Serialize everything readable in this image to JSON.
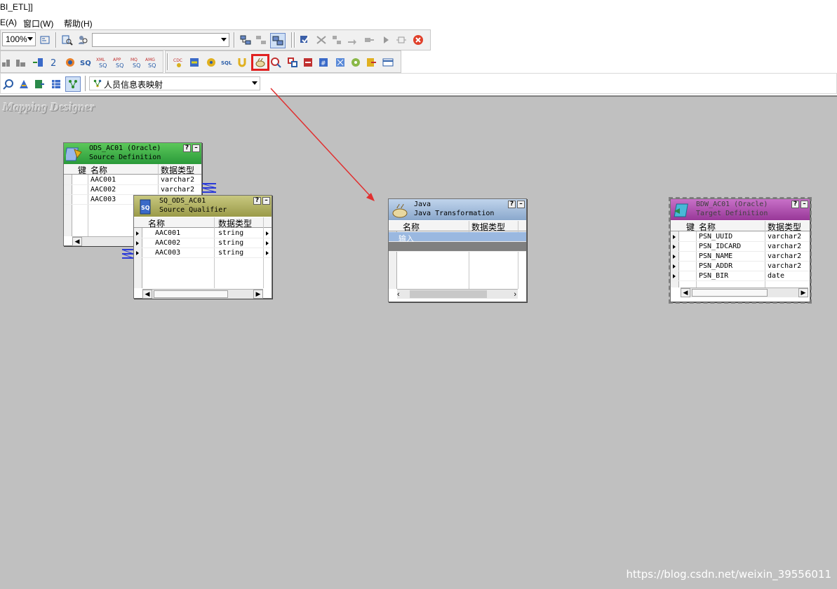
{
  "window": {
    "title": "BI_ETL]]"
  },
  "menu": [
    {
      "label": "E(A)"
    },
    {
      "label": "窗口(W)"
    },
    {
      "label": "帮助(H)"
    }
  ],
  "toolbar1": {
    "zoom_value": "100%",
    "search_value": ""
  },
  "toolbar3": {
    "mapping_selector": "人员信息表映射"
  },
  "canvas": {
    "label": "Mapping Designer"
  },
  "source": {
    "title": "ODS_AC01 (Oracle)",
    "subtitle": "Source Definition",
    "col_key": "键",
    "col_name": "名称",
    "col_type": "数据类型",
    "rows": [
      {
        "name": "AAC001",
        "type": "varchar2"
      },
      {
        "name": "AAC002",
        "type": "varchar2"
      },
      {
        "name": "AAC003",
        "type": ""
      }
    ]
  },
  "qualifier": {
    "title": "SQ_ODS_AC01",
    "subtitle": "Source Qualifier",
    "col_name": "名称",
    "col_type": "数据类型",
    "rows": [
      {
        "name": "AAC001",
        "type": "string"
      },
      {
        "name": "AAC002",
        "type": "string"
      },
      {
        "name": "AAC003",
        "type": "string"
      }
    ]
  },
  "java": {
    "title": "Java",
    "subtitle": "Java Transformation",
    "col_name": "名称",
    "col_type": "数据类型",
    "rows": [
      {
        "name": "输入",
        "type": ""
      }
    ]
  },
  "target": {
    "title": "BDW_AC01 (Oracle)",
    "subtitle": "Target Definition",
    "col_key": "键",
    "col_name": "名称",
    "col_type": "数据类型",
    "rows": [
      {
        "name": "PSN_UUID",
        "type": "varchar2"
      },
      {
        "name": "PSN_IDCARD",
        "type": "varchar2"
      },
      {
        "name": "PSN_NAME",
        "type": "varchar2"
      },
      {
        "name": "PSN_ADDR",
        "type": "varchar2"
      },
      {
        "name": "PSN_BIR",
        "type": "date"
      }
    ]
  },
  "watermark": "https://blog.csdn.net/weixin_39556011",
  "colors": {
    "source_header": "#3aa84a",
    "qualifier_header": "#a8a858",
    "java_header": "#9ab8d8",
    "target_header": "#a848a8",
    "highlight": "#e02020",
    "arrow": "#e03030"
  }
}
